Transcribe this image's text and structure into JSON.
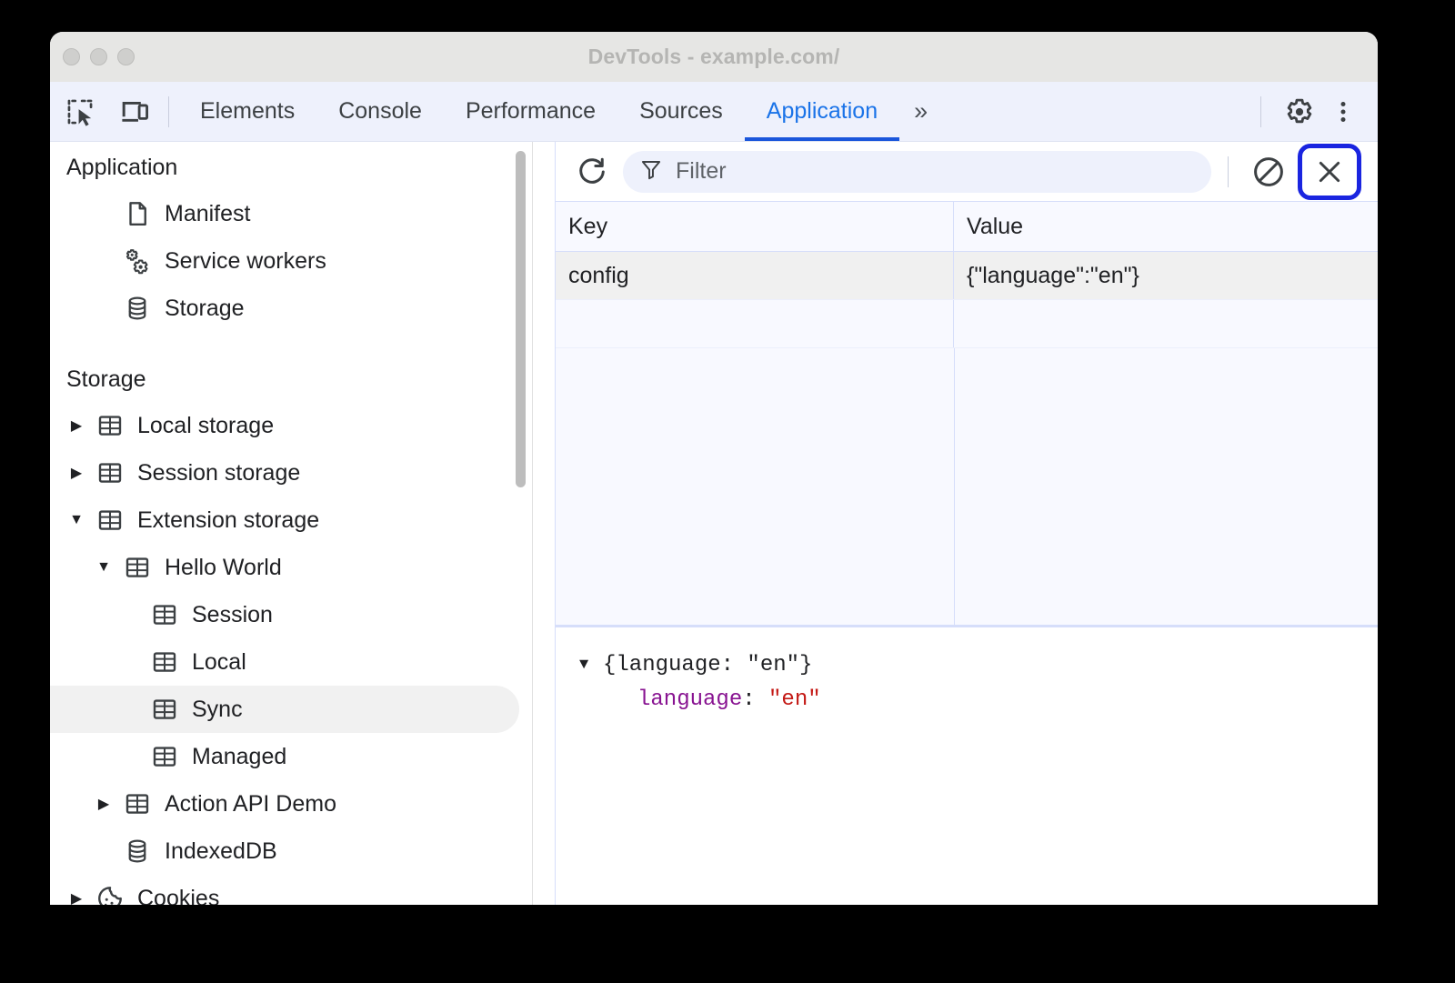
{
  "window": {
    "title": "DevTools - example.com/",
    "traffic_lights": [
      "close",
      "minimize",
      "maximize"
    ]
  },
  "tabbar": {
    "left_icons": [
      {
        "name": "inspect-element-icon",
        "label": "Inspect element"
      },
      {
        "name": "device-toolbar-icon",
        "label": "Toggle device toolbar"
      }
    ],
    "tabs": [
      {
        "label": "Elements",
        "active": false
      },
      {
        "label": "Console",
        "active": false
      },
      {
        "label": "Performance",
        "active": false
      },
      {
        "label": "Sources",
        "active": false
      },
      {
        "label": "Application",
        "active": true
      }
    ],
    "more_tabs": "»",
    "right_icons": [
      {
        "name": "settings-gear-icon",
        "label": "Settings"
      },
      {
        "name": "more-options-icon",
        "label": "Customize and control DevTools"
      }
    ]
  },
  "sidebar": {
    "sections": [
      {
        "heading": "Application",
        "items": [
          {
            "label": "Manifest",
            "icon": "document-icon",
            "indent": 1,
            "twisty": "none",
            "selected": false
          },
          {
            "label": "Service workers",
            "icon": "gears-icon",
            "indent": 1,
            "twisty": "none",
            "selected": false
          },
          {
            "label": "Storage",
            "icon": "database-icon",
            "indent": 1,
            "twisty": "none",
            "selected": false
          }
        ]
      },
      {
        "heading": "Storage",
        "items": [
          {
            "label": "Local storage",
            "icon": "table-icon",
            "indent": 0,
            "twisty": "collapsed",
            "selected": false
          },
          {
            "label": "Session storage",
            "icon": "table-icon",
            "indent": 0,
            "twisty": "collapsed",
            "selected": false
          },
          {
            "label": "Extension storage",
            "icon": "table-icon",
            "indent": 0,
            "twisty": "expanded",
            "selected": false
          },
          {
            "label": "Hello World",
            "icon": "table-icon",
            "indent": 1,
            "twisty": "expanded",
            "selected": false
          },
          {
            "label": "Session",
            "icon": "table-icon",
            "indent": 2,
            "twisty": "none",
            "selected": false
          },
          {
            "label": "Local",
            "icon": "table-icon",
            "indent": 2,
            "twisty": "none",
            "selected": false
          },
          {
            "label": "Sync",
            "icon": "table-icon",
            "indent": 2,
            "twisty": "none",
            "selected": true
          },
          {
            "label": "Managed",
            "icon": "table-icon",
            "indent": 2,
            "twisty": "none",
            "selected": false
          },
          {
            "label": "Action API Demo",
            "icon": "table-icon",
            "indent": 1,
            "twisty": "collapsed",
            "selected": false
          },
          {
            "label": "IndexedDB",
            "icon": "database-icon",
            "indent": 1,
            "twisty": "none",
            "selected": false
          },
          {
            "label": "Cookies",
            "icon": "cookie-icon",
            "indent": 0,
            "twisty": "collapsed",
            "selected": false
          }
        ]
      }
    ]
  },
  "panel": {
    "toolbar": {
      "refresh": {
        "name": "refresh-icon",
        "label": "Refresh"
      },
      "filter_placeholder": "Filter",
      "filter_value": "",
      "filter_icon": "funnel-icon",
      "clear": {
        "name": "clear-all-icon",
        "label": "Clear all"
      },
      "close": {
        "name": "close-icon",
        "label": "Delete selected",
        "glyph": "×",
        "focused": true
      }
    },
    "table": {
      "columns": [
        "Key",
        "Value"
      ],
      "rows": [
        {
          "Key": "config",
          "Value": "{\"language\":\"en\"}"
        }
      ]
    },
    "preview": {
      "root_line": "{language: \"en\"}",
      "expanded": true,
      "entries": [
        {
          "key": "language",
          "separator": ": ",
          "value": "\"en\""
        }
      ]
    }
  },
  "colors": {
    "accent": "#1a73e8",
    "tab_underline": "#1a56db",
    "focus_ring": "#1a25e0",
    "json_key": "#881391",
    "json_string": "#c41a16",
    "toolbar_bg": "#eef1fc",
    "selected_row": "#f1f1f1"
  }
}
